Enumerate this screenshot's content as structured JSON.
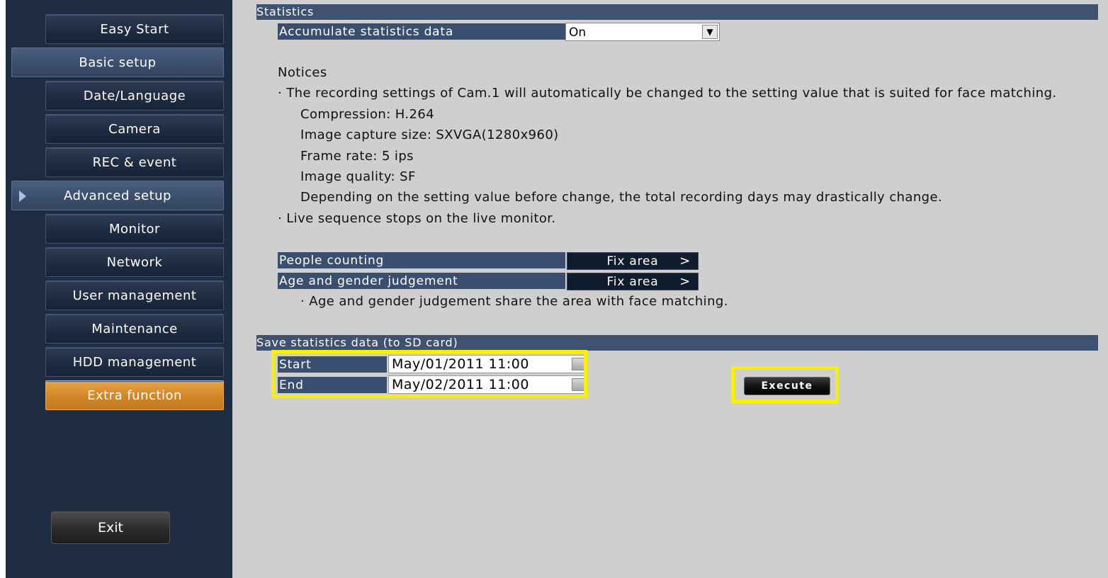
{
  "sidebar": {
    "items": [
      {
        "label": "Easy Start",
        "kind": "sub"
      },
      {
        "label": "Basic setup",
        "kind": "category"
      },
      {
        "label": "Date/Language",
        "kind": "sub"
      },
      {
        "label": "Camera",
        "kind": "sub"
      },
      {
        "label": "REC & event",
        "kind": "sub"
      },
      {
        "label": "Advanced setup",
        "kind": "category",
        "selected": true
      },
      {
        "label": "Monitor",
        "kind": "sub"
      },
      {
        "label": "Network",
        "kind": "sub"
      },
      {
        "label": "User management",
        "kind": "sub"
      },
      {
        "label": "Maintenance",
        "kind": "sub"
      },
      {
        "label": "HDD management",
        "kind": "sub"
      },
      {
        "label": "Extra function",
        "kind": "sub",
        "active": true
      }
    ],
    "exit_label": "Exit"
  },
  "statistics": {
    "header": "Statistics",
    "accumulate_label": "Accumulate statistics data",
    "accumulate_value": "On",
    "notices_title": "Notices",
    "notices": [
      "· The recording settings of Cam.1 will automatically be changed to the setting value that is suited for face matching.",
      "Compression: H.264",
      "Image capture size: SXVGA(1280x960)",
      "Frame rate: 5 ips",
      "Image quality: SF",
      "Depending on the setting value before change, the total recording days may drastically change.",
      "· Live sequence stops on the live monitor."
    ],
    "people_counting_label": "People counting",
    "age_gender_label": "Age and gender judgement",
    "fix_area_label": "Fix area",
    "fix_area_chevron": ">",
    "age_gender_note": "· Age and gender judgement share the area with face matching."
  },
  "save": {
    "header": "Save statistics data (to SD card)",
    "start_label": "Start",
    "start_value": "May/01/2011 11:00",
    "end_label": "End",
    "end_value": "May/02/2011 11:00",
    "execute_label": "Execute"
  },
  "colors": {
    "sidebar_bg": "#1e2d44",
    "main_bg": "#cfcfcf",
    "header_bg": "#3f5272",
    "active_orange": "#cf8425",
    "highlight": "#f7f000"
  }
}
